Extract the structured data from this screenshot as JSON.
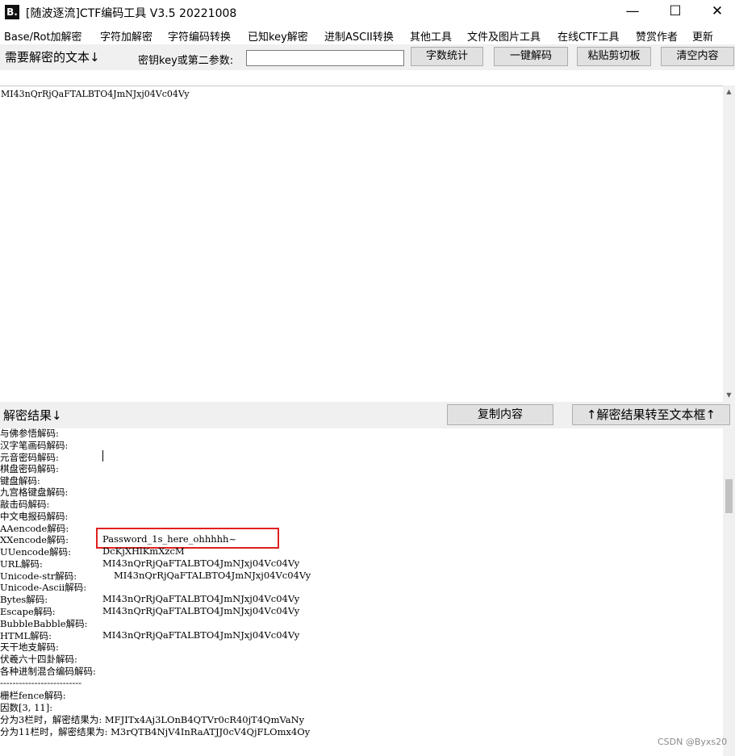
{
  "window": {
    "title": "[随波逐流]CTF编码工具 V3.5 20221008",
    "app_icon": "B.",
    "controls": {
      "minimize": "—",
      "maximize": "☐",
      "close": "✕"
    }
  },
  "menu": [
    "Base/Rot加解密",
    "字符加解密",
    "字符编码转换",
    "已知key解密",
    "进制ASCII转换",
    "其他工具",
    "文件及图片工具",
    "在线CTF工具",
    "赞赏作者",
    "更新"
  ],
  "toolbar": {
    "input_label": "需要解密的文本↓",
    "key_label": "密钥key或第二参数:",
    "key_value": "",
    "buttons": [
      "字数统计",
      "一键解码",
      "粘贴剪切板",
      "清空内容"
    ]
  },
  "input_text": "MI43nQrRjQaFTALBTO4JmNJxj04Vc04Vy",
  "result_bar": {
    "label": "解密结果↓",
    "copy_button": "复制内容",
    "transfer_button": "↑解密结果转至文本框↑"
  },
  "results": [
    {
      "name": "与佛参悟解码:",
      "value": ""
    },
    {
      "name": "汉字笔画码解码:",
      "value": ""
    },
    {
      "name": "元音密码解码:",
      "value": ""
    },
    {
      "name": "棋盘密码解码:",
      "value": ""
    },
    {
      "name": "键盘解码:",
      "value": ""
    },
    {
      "name": "九宫格键盘解码:",
      "value": ""
    },
    {
      "name": "敲击码解码:",
      "value": ""
    },
    {
      "name": "中文电报码解码:",
      "value": ""
    },
    {
      "name": "AAencode解码:",
      "value": ""
    },
    {
      "name": "XXencode解码:",
      "value": "Password_1s_here_ohhhhh~"
    },
    {
      "name": "UUencode解码:",
      "value": "DcKjXHlKmXzcM"
    },
    {
      "name": "URL解码:",
      "value": "MI43nQrRjQaFTALBTO4JmNJxj04Vc04Vy"
    },
    {
      "name": "Unicode-str解码:",
      "value": "MI43nQrRjQaFTALBTO4JmNJxj04Vc04Vy"
    },
    {
      "name": "Unicode-Ascii解码:",
      "value": ""
    },
    {
      "name": "Bytes解码:",
      "value": "MI43nQrRjQaFTALBTO4JmNJxj04Vc04Vy"
    },
    {
      "name": "Escape解码:",
      "value": "MI43nQrRjQaFTALBTO4JmNJxj04Vc04Vy"
    },
    {
      "name": "BubbleBabble解码:",
      "value": ""
    },
    {
      "name": "HTML解码:",
      "value": "MI43nQrRjQaFTALBTO4JmNJxj04Vc04Vy"
    },
    {
      "name": "天干地支解码:",
      "value": ""
    },
    {
      "name": "伏羲六十四卦解码:",
      "value": ""
    },
    {
      "name": "各种进制混合编码解码:",
      "value": ""
    },
    {
      "name": "--------------------------",
      "value": ""
    },
    {
      "name": "栅栏fence解码:",
      "value": ""
    },
    {
      "name": "因数[3, 11]:",
      "value": ""
    },
    {
      "name": "分为3栏时，解密结果为: MFJITx4Aj3LOnB4QTVr0cR40jT4QmVaNy",
      "value": ""
    },
    {
      "name": "分为11栏时，解密结果为: M3rQTB4NjV4InRaATJJ0cV4QjFLOmx4Oy",
      "value": ""
    }
  ],
  "watermark": "CSDN @Byxs20",
  "colors": {
    "highlight_border": "#e02020",
    "toolbar_bg": "#f0f0f0",
    "button_bg": "#e1e1e1"
  }
}
